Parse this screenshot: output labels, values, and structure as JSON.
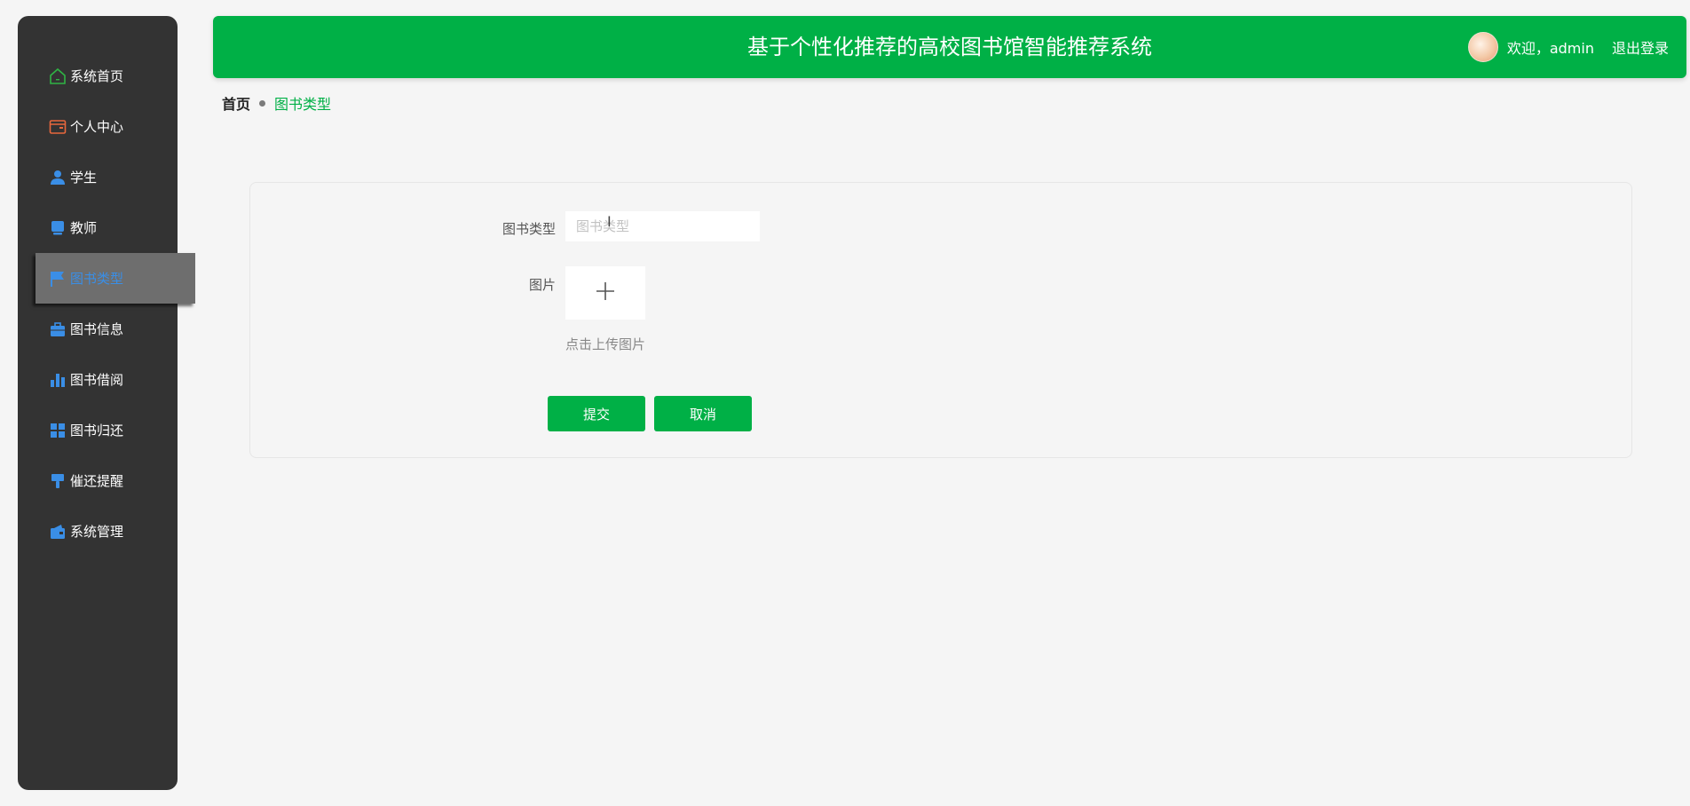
{
  "header": {
    "title": "基于个性化推荐的高校图书馆智能推荐系统",
    "welcome": "欢迎，admin",
    "logout": "退出登录"
  },
  "sidebar": {
    "items": [
      {
        "label": "系统首页",
        "icon": "home-icon",
        "color": "#2fb344"
      },
      {
        "label": "个人中心",
        "icon": "wallet-icon",
        "color": "#e8673c"
      },
      {
        "label": "学生",
        "icon": "user-icon",
        "color": "#3a8ee6"
      },
      {
        "label": "教师",
        "icon": "monitor-icon",
        "color": "#3a8ee6"
      },
      {
        "label": "图书类型",
        "icon": "flag-icon",
        "color": "#3a8ee6",
        "active": true
      },
      {
        "label": "图书信息",
        "icon": "briefcase-icon",
        "color": "#3a8ee6"
      },
      {
        "label": "图书借阅",
        "icon": "bar-chart-icon",
        "color": "#3a8ee6"
      },
      {
        "label": "图书归还",
        "icon": "grid-icon",
        "color": "#3a8ee6"
      },
      {
        "label": "催还提醒",
        "icon": "brush-icon",
        "color": "#3a8ee6"
      },
      {
        "label": "系统管理",
        "icon": "wallet-settings-icon",
        "color": "#3a8ee6"
      }
    ]
  },
  "breadcrumb": {
    "home": "首页",
    "current": "图书类型"
  },
  "form": {
    "type_label": "图书类型",
    "type_placeholder": "图书类型",
    "type_value": "",
    "image_label": "图片",
    "upload_hint": "点击上传图片",
    "submit": "提交",
    "cancel": "取消"
  },
  "colors": {
    "accent": "#00b046",
    "sidebar_bg": "#333333",
    "active_text": "#3a8ee6"
  }
}
